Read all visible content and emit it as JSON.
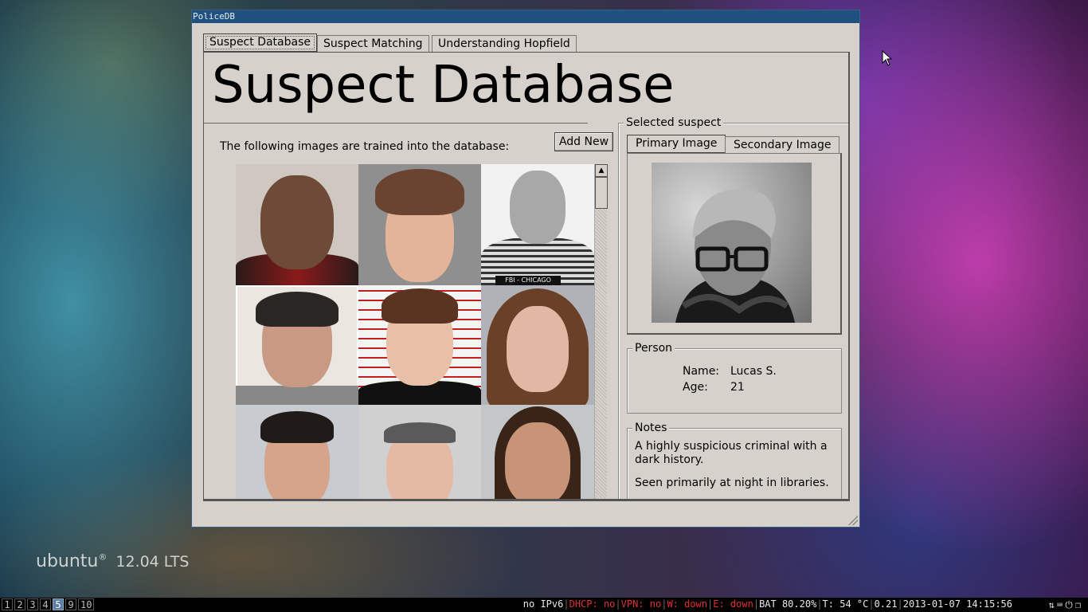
{
  "desktop": {
    "brand": "ubuntu",
    "brand_mark": "®",
    "version": "12.04 LTS"
  },
  "window": {
    "title": "PoliceDB",
    "tabs": [
      {
        "label": "Suspect Database",
        "active": true
      },
      {
        "label": "Suspect Matching",
        "active": false
      },
      {
        "label": "Understanding Hopfield",
        "active": false
      }
    ]
  },
  "database": {
    "title": "Suspect Database",
    "intro": "The following images are trained into the database:",
    "add_label": "Add New"
  },
  "selected": {
    "legend": "Selected suspect",
    "tabs": [
      {
        "label": "Primary Image",
        "active": true
      },
      {
        "label": "Secondary Image",
        "active": false
      }
    ],
    "person_legend": "Person",
    "name_label": "Name:",
    "name_value": "Lucas S.",
    "age_label": "Age:",
    "age_value": "21",
    "notes_legend": "Notes",
    "notes": [
      "A highly suspicious criminal with a dark history.",
      "Seen primarily at night in libraries."
    ]
  },
  "photo_text": {
    "fbi": "FBI - CHICAGO"
  },
  "taskbar": {
    "workspaces": [
      "1",
      "2",
      "3",
      "4",
      "5",
      "9",
      "10"
    ],
    "active_workspace": "5",
    "ipv6": "no IPv6",
    "dhcp": "DHCP: no",
    "vpn": "VPN: no",
    "wlan": "W: down",
    "eth": "E: down",
    "bat": "BAT 80.20%",
    "temp": "T: 54 °C",
    "load": "0.21",
    "datetime": "2013-01-07 14:15:56"
  },
  "colors": {
    "titlebar": "#1f5080",
    "window_bg": "#d6d2cb",
    "status_red": "#e03030"
  }
}
